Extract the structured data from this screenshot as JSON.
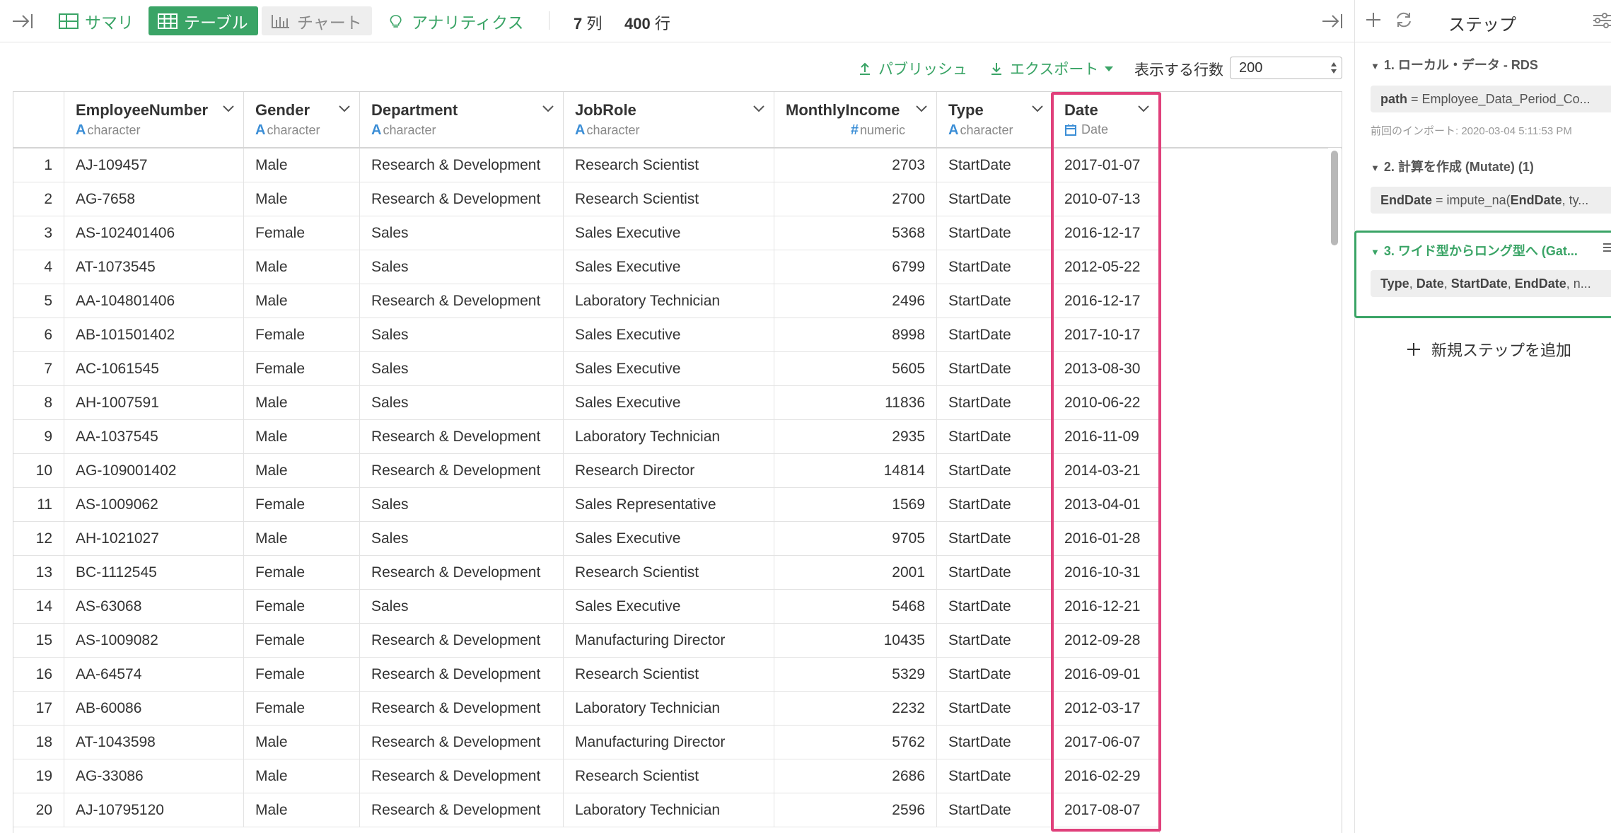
{
  "toolbar": {
    "tabs": [
      {
        "label": "サマリ",
        "icon": "summary-grid-icon"
      },
      {
        "label": "テーブル",
        "icon": "table-icon",
        "active": true
      },
      {
        "label": "チャート",
        "icon": "bar-chart-icon"
      },
      {
        "label": "アナリティクス",
        "icon": "lightbulb-icon"
      }
    ],
    "cols_count": "7",
    "cols_unit": "列",
    "rows_count": "400",
    "rows_unit": "行"
  },
  "subbar": {
    "publish_label": "パブリッシュ",
    "export_label": "エクスポート",
    "rows_label": "表示する行数",
    "rows_value": "200"
  },
  "table": {
    "columns": [
      {
        "name": "EmployeeNumber",
        "type": "character",
        "type_icon": "A"
      },
      {
        "name": "Gender",
        "type": "character",
        "type_icon": "A"
      },
      {
        "name": "Department",
        "type": "character",
        "type_icon": "A"
      },
      {
        "name": "JobRole",
        "type": "character",
        "type_icon": "A"
      },
      {
        "name": "MonthlyIncome",
        "type": "numeric",
        "type_icon": "#"
      },
      {
        "name": "Type",
        "type": "character",
        "type_icon": "A"
      },
      {
        "name": "Date",
        "type": "Date",
        "type_icon": "calendar-icon"
      }
    ],
    "rows": [
      [
        "1",
        "AJ-109457",
        "Male",
        "Research & Development",
        "Research Scientist",
        "2703",
        "StartDate",
        "2017-01-07"
      ],
      [
        "2",
        "AG-7658",
        "Male",
        "Research & Development",
        "Research Scientist",
        "2700",
        "StartDate",
        "2010-07-13"
      ],
      [
        "3",
        "AS-102401406",
        "Female",
        "Sales",
        "Sales Executive",
        "5368",
        "StartDate",
        "2016-12-17"
      ],
      [
        "4",
        "AT-1073545",
        "Male",
        "Sales",
        "Sales Executive",
        "6799",
        "StartDate",
        "2012-05-22"
      ],
      [
        "5",
        "AA-104801406",
        "Male",
        "Research & Development",
        "Laboratory Technician",
        "2496",
        "StartDate",
        "2016-12-17"
      ],
      [
        "6",
        "AB-101501402",
        "Female",
        "Sales",
        "Sales Executive",
        "8998",
        "StartDate",
        "2017-10-17"
      ],
      [
        "7",
        "AC-1061545",
        "Female",
        "Sales",
        "Sales Executive",
        "5605",
        "StartDate",
        "2013-08-30"
      ],
      [
        "8",
        "AH-1007591",
        "Male",
        "Sales",
        "Sales Executive",
        "11836",
        "StartDate",
        "2010-06-22"
      ],
      [
        "9",
        "AA-1037545",
        "Male",
        "Research & Development",
        "Laboratory Technician",
        "2935",
        "StartDate",
        "2016-11-09"
      ],
      [
        "10",
        "AG-109001402",
        "Male",
        "Research & Development",
        "Research Director",
        "14814",
        "StartDate",
        "2014-03-21"
      ],
      [
        "11",
        "AS-1009062",
        "Female",
        "Sales",
        "Sales Representative",
        "1569",
        "StartDate",
        "2013-04-01"
      ],
      [
        "12",
        "AH-1021027",
        "Male",
        "Sales",
        "Sales Executive",
        "9705",
        "StartDate",
        "2016-01-28"
      ],
      [
        "13",
        "BC-1112545",
        "Female",
        "Research & Development",
        "Research Scientist",
        "2001",
        "StartDate",
        "2016-10-31"
      ],
      [
        "14",
        "AS-63068",
        "Female",
        "Sales",
        "Sales Executive",
        "5468",
        "StartDate",
        "2016-12-21"
      ],
      [
        "15",
        "AS-1009082",
        "Female",
        "Research & Development",
        "Manufacturing Director",
        "10435",
        "StartDate",
        "2012-09-28"
      ],
      [
        "16",
        "AA-64574",
        "Female",
        "Research & Development",
        "Research Scientist",
        "5329",
        "StartDate",
        "2016-09-01"
      ],
      [
        "17",
        "AB-60086",
        "Female",
        "Research & Development",
        "Laboratory Technician",
        "2232",
        "StartDate",
        "2012-03-17"
      ],
      [
        "18",
        "AT-1043598",
        "Male",
        "Research & Development",
        "Manufacturing Director",
        "5762",
        "StartDate",
        "2017-06-07"
      ],
      [
        "19",
        "AG-33086",
        "Male",
        "Research & Development",
        "Research Scientist",
        "2686",
        "StartDate",
        "2016-02-29"
      ],
      [
        "20",
        "AJ-10795120",
        "Male",
        "Research & Development",
        "Laboratory Technician",
        "2596",
        "StartDate",
        "2017-08-07"
      ]
    ]
  },
  "panel": {
    "title": "ステップ",
    "steps": [
      {
        "title": "1. ローカル・データ - RDS",
        "detail_key": "path",
        "detail_rest": " = Employee_Data_Period_Co...",
        "meta": "前回のインポート: 2020-03-04 5:11:53 PM"
      },
      {
        "title": "2. 計算を作成 (Mutate) (1)",
        "detail_key": "EndDate",
        "detail_rest": " = impute_na(",
        "detail_key2": "EndDate",
        "detail_rest2": ", ty..."
      },
      {
        "title": "3. ワイド型からロング型へ (Gat...",
        "detail_parts": [
          "Type",
          ", ",
          "Date",
          ", ",
          "StartDate",
          ", ",
          "EndDate",
          ", n..."
        ]
      }
    ],
    "add_step_label": "新規ステップを追加"
  },
  "colors": {
    "accent_green": "#3aa466",
    "highlight_pink": "#e0407b",
    "type_blue": "#3b8ed6"
  }
}
